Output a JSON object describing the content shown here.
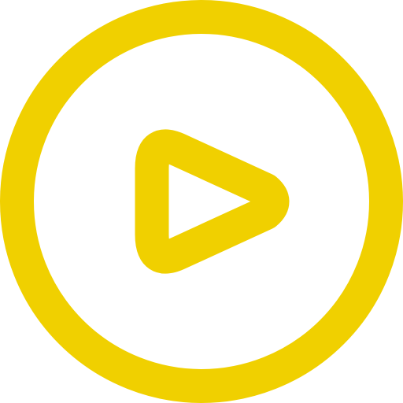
{
  "icon": {
    "name": "play-circle-icon",
    "color": "#F0D000",
    "background": "#FFFFFF"
  }
}
